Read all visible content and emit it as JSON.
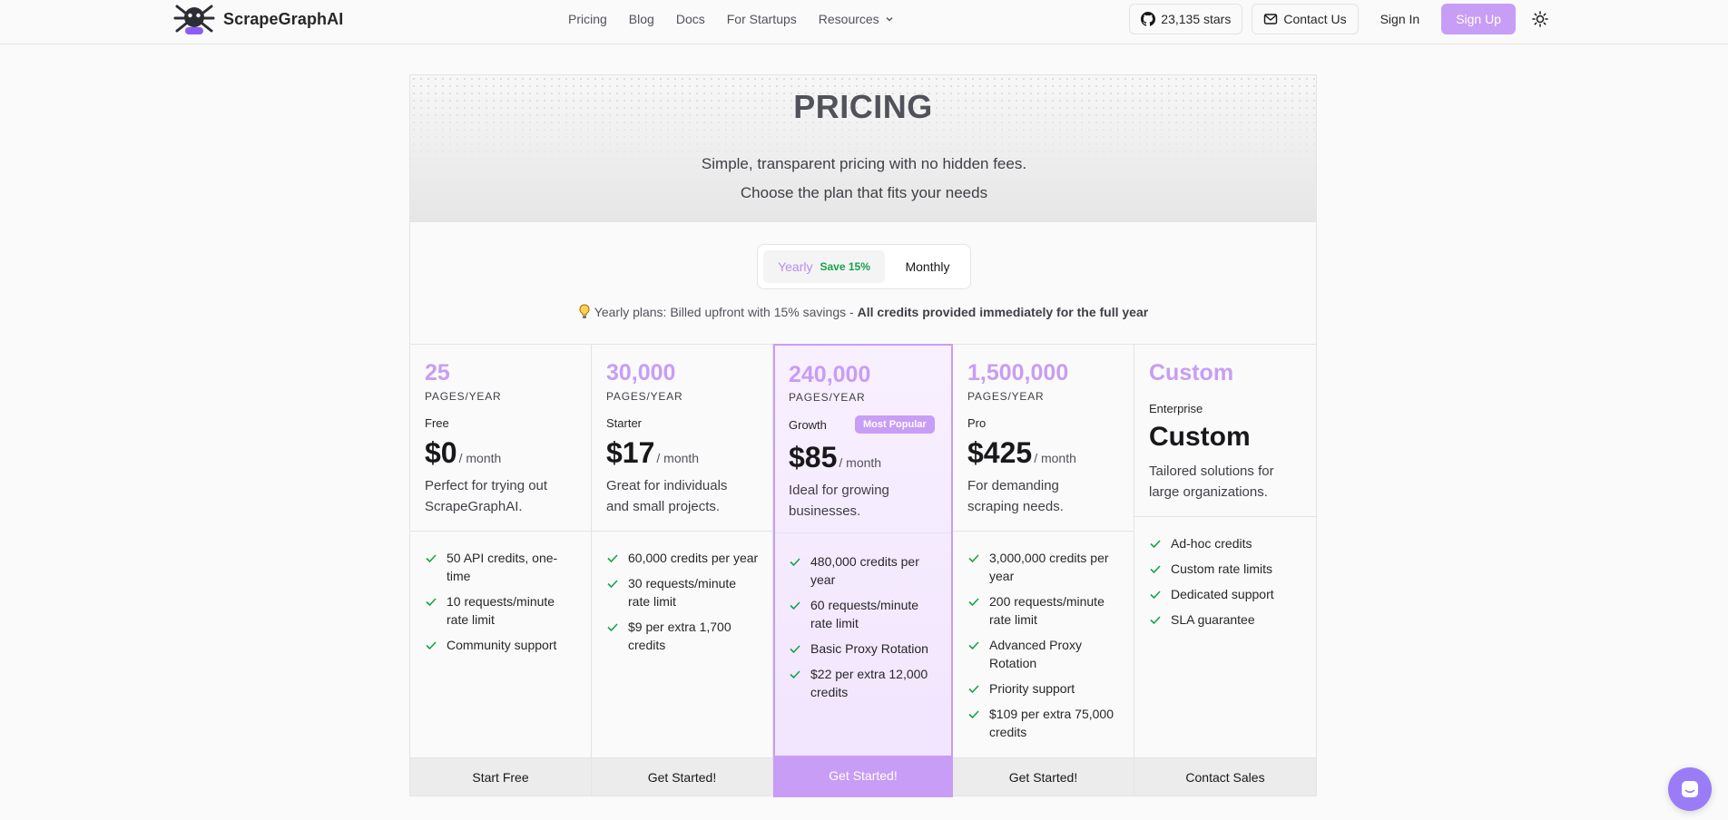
{
  "brand": {
    "name": "ScrapeGraphAI"
  },
  "nav": {
    "links": [
      "Pricing",
      "Blog",
      "Docs",
      "For Startups",
      "Resources"
    ],
    "github_stars": "23,135 stars",
    "contact": "Contact Us",
    "signin": "Sign In",
    "signup": "Sign Up"
  },
  "hero": {
    "title": "PRICING",
    "subtitle": "Simple, transparent pricing with no hidden fees. Choose the plan that fits your needs"
  },
  "billing": {
    "yearly": "Yearly",
    "save": "Save 15%",
    "monthly": "Monthly",
    "selected": "Yearly",
    "note": "Yearly plans: Billed upfront with 15% savings - ",
    "note_bold": "All credits provided immediately for the full year"
  },
  "plans": [
    {
      "pages": "25",
      "unit": "PAGES/YEAR",
      "tier": "Free",
      "price": "$0",
      "per": "/ month",
      "desc": "Perfect for trying out ScrapeGraphAI.",
      "features": [
        "50 API credits, one-time",
        "10 requests/minute rate limit",
        "Community support"
      ],
      "cta": "Start Free"
    },
    {
      "pages": "30,000",
      "unit": "PAGES/YEAR",
      "tier": "Starter",
      "price": "$17",
      "per": "/ month",
      "desc": "Great for individuals and small projects.",
      "features": [
        "60,000 credits per year",
        "30 requests/minute rate limit",
        "$9 per extra 1,700 credits"
      ],
      "cta": "Get Started!"
    },
    {
      "pages": "240,000",
      "unit": "PAGES/YEAR",
      "tier": "Growth",
      "badge": "Most Popular",
      "price": "$85",
      "per": "/ month",
      "desc": "Ideal for growing businesses.",
      "features": [
        "480,000 credits per year",
        "60 requests/minute rate limit",
        "Basic Proxy Rotation",
        "$22 per extra 12,000 credits"
      ],
      "cta": "Get Started!"
    },
    {
      "pages": "1,500,000",
      "unit": "PAGES/YEAR",
      "tier": "Pro",
      "price": "$425",
      "per": "/ month",
      "desc": "For demanding scraping needs.",
      "features": [
        "3,000,000 credits per year",
        "200 requests/minute rate limit",
        "Advanced Proxy Rotation",
        "Priority support",
        "$109 per extra 75,000 credits"
      ],
      "cta": "Get Started!"
    },
    {
      "pages": "Custom",
      "tier": "Enterprise",
      "price": "Custom",
      "desc": "Tailored solutions for large organizations.",
      "features": [
        "Ad-hoc credits",
        "Custom rate limits",
        "Dedicated support",
        "SLA guarantee"
      ],
      "cta": "Contact Sales"
    }
  ],
  "colors": {
    "accent": "#c89df5",
    "check": "#16a34a",
    "save": "#16a34a"
  },
  "icons": [
    "logo-spider-icon",
    "chevron-down-icon",
    "github-icon",
    "mail-icon",
    "sun-icon",
    "lightbulb-icon",
    "check-icon",
    "chat-icon"
  ]
}
